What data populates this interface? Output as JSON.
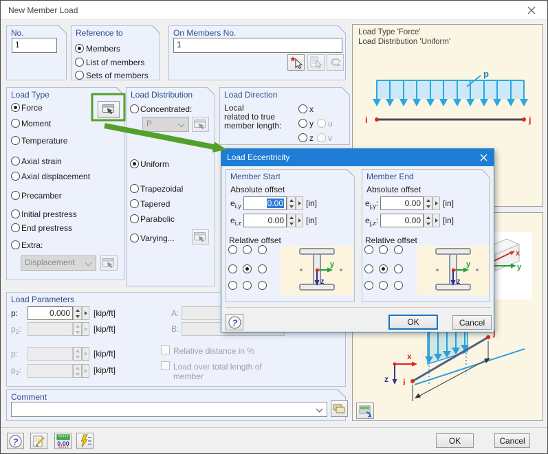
{
  "colors": {
    "accent_blue": "#1d7dd7",
    "annotation_green": "#54a02b",
    "load_blue": "#29a8e0",
    "node_red": "#e0251b",
    "axis_green": "#1fa03c",
    "axis_navy": "#2d2a8f",
    "group_header_blue": "#2b4d8e"
  },
  "window": {
    "title": "New Member Load"
  },
  "no_group": {
    "title": "No.",
    "value": "1"
  },
  "reference_group": {
    "title": "Reference to",
    "options": [
      {
        "label": "Members"
      },
      {
        "label": "List of members"
      },
      {
        "label": "Sets of members"
      }
    ],
    "selected": "Members"
  },
  "on_members_group": {
    "title": "On Members No.",
    "value": "1"
  },
  "load_type_group": {
    "title": "Load Type",
    "force": "Force",
    "moment": "Moment",
    "temperature": "Temperature",
    "axial_strain": "Axial strain",
    "axial_displacement": "Axial displacement",
    "precamber": "Precamber",
    "initial_prestress": "Initial prestress",
    "end_prestress": "End prestress",
    "extra": "Extra:",
    "extra_value": "Displacement",
    "selected": "Force"
  },
  "load_distribution_group": {
    "title": "Load Distribution",
    "concentrated": "Concentrated:",
    "concentrated_value": "P",
    "uniform": "Uniform",
    "trapezoidal": "Trapezoidal",
    "tapered": "Tapered",
    "parabolic": "Parabolic",
    "varying": "Varying...",
    "selected": "Uniform"
  },
  "load_direction_group": {
    "title": "Load Direction",
    "caption": [
      "Local",
      "related to true",
      "member length:"
    ],
    "x": "x",
    "y": "y",
    "z": "z",
    "u": "u",
    "v": "v"
  },
  "preview": {
    "caption_line1": "Load Type 'Force'",
    "caption_line2": "Load Distribution 'Uniform'",
    "p": "p",
    "i": "i",
    "j": "j",
    "axis_x": "x",
    "axis_y": "y",
    "axis_z": "z"
  },
  "load_parameters_group": {
    "title": "Load Parameters",
    "rows": [
      {
        "base": "p",
        "sub": "",
        "colon": ":",
        "value": "0.000",
        "unit": "[kip/ft]"
      },
      {
        "base": "p",
        "sub": "2",
        "colon": ":",
        "value": "",
        "unit": "[kip/ft]"
      },
      {
        "base": "p",
        "sub": "",
        "colon": ":",
        "value": "",
        "unit": "[kip/ft]"
      },
      {
        "base": "p",
        "sub": "2",
        "colon": ":",
        "value": "",
        "unit": "[kip/ft]"
      }
    ],
    "a": "A:",
    "b": "B:",
    "relative_distance": "Relative distance in %",
    "total_length_1": "Load over total length of",
    "total_length_2": "member"
  },
  "comment_group": {
    "title": "Comment",
    "value": ""
  },
  "buttons": {
    "ok": "OK",
    "cancel": "Cancel"
  },
  "eccentricity_dialog": {
    "title": "Load Eccentricity",
    "member_start": {
      "title": "Member Start",
      "absolute": "Absolute offset",
      "e1": {
        "base": "e",
        "sub": "i,y",
        "colon": "",
        "value": "0.00",
        "unit": "[in]"
      },
      "e2": {
        "base": "e",
        "sub": "i,z",
        "colon": "",
        "value": "0.00",
        "unit": "[in]"
      },
      "relative": "Relative offset",
      "axis_y": "y",
      "axis_z": "z"
    },
    "member_end": {
      "title": "Member End",
      "absolute": "Absolute offset",
      "e1": {
        "base": "e",
        "sub": "j,y",
        "colon": ":",
        "value": "0.00",
        "unit": "[in]"
      },
      "e2": {
        "base": "e",
        "sub": "j,z",
        "colon": ":",
        "value": "0.00",
        "unit": "[in]"
      },
      "relative": "Relative offset",
      "axis_y": "y",
      "axis_z": "z"
    },
    "ok": "OK",
    "cancel": "Cancel"
  }
}
